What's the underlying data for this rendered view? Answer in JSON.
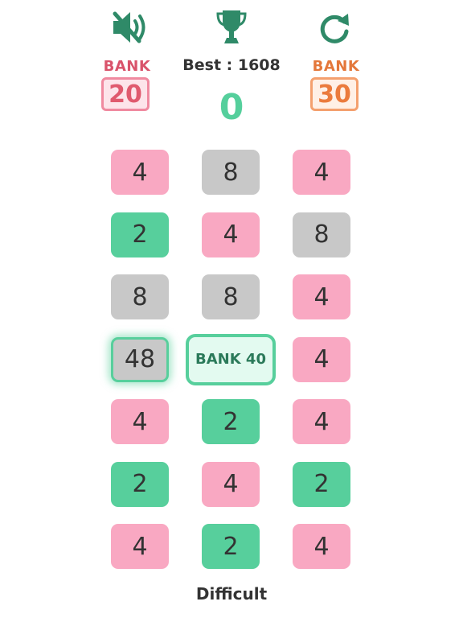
{
  "header": {
    "mute_icon": "speaker-muted-icon",
    "trophy_icon": "trophy-icon",
    "restart_icon": "restart-icon",
    "best_text": "Best : 1608",
    "score": "0"
  },
  "banks": {
    "left": {
      "label": "BANK",
      "value": "20"
    },
    "right": {
      "label": "BANK",
      "value": "30"
    }
  },
  "grid": {
    "rows": [
      [
        {
          "value": "4",
          "color": "pink"
        },
        {
          "value": "8",
          "color": "gray"
        },
        {
          "value": "4",
          "color": "pink"
        }
      ],
      [
        {
          "value": "2",
          "color": "green"
        },
        {
          "value": "4",
          "color": "pink"
        },
        {
          "value": "8",
          "color": "gray"
        }
      ],
      [
        {
          "value": "8",
          "color": "gray"
        },
        {
          "value": "8",
          "color": "gray"
        },
        {
          "value": "4",
          "color": "pink"
        }
      ],
      [
        {
          "value": "48",
          "color": "gray",
          "selected": true
        },
        {
          "value": "BANK 40",
          "color": "bank"
        },
        {
          "value": "4",
          "color": "pink"
        }
      ],
      [
        {
          "value": "4",
          "color": "pink"
        },
        {
          "value": "2",
          "color": "green"
        },
        {
          "value": "4",
          "color": "pink"
        }
      ],
      [
        {
          "value": "2",
          "color": "green"
        },
        {
          "value": "4",
          "color": "pink"
        },
        {
          "value": "2",
          "color": "green"
        }
      ],
      [
        {
          "value": "4",
          "color": "pink"
        },
        {
          "value": "2",
          "color": "green"
        },
        {
          "value": "4",
          "color": "pink"
        }
      ]
    ]
  },
  "footer": {
    "difficulty": "Difficult"
  },
  "colors": {
    "icon_green": "#2f8a68",
    "accent_green": "#57cf9c",
    "pink": "#f9a8c2",
    "gray": "#c8c8c8",
    "bank_left": "#e05a6e",
    "bank_right": "#eb7b3d"
  }
}
